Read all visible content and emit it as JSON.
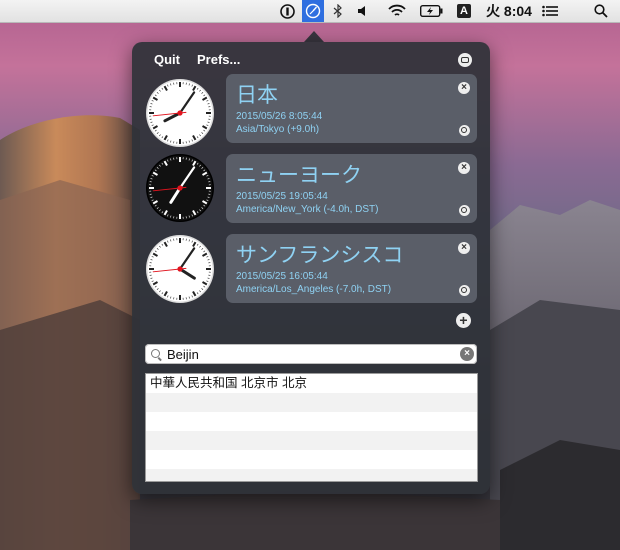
{
  "menubar": {
    "icons": [
      "1password-icon",
      "world-clock-icon",
      "bluetooth-icon",
      "volume-icon",
      "wifi-icon",
      "battery-icon",
      "input-source-icon",
      "notification-list-icon",
      "spotlight-icon"
    ],
    "input_source": "A",
    "clock": "火 8:04"
  },
  "popover": {
    "quit_label": "Quit",
    "prefs_label": "Prefs...",
    "clocks": [
      {
        "city": "日本",
        "datetime": "2015/05/26 8:05:44",
        "tz": "Asia/Tokyo (+9.0h)",
        "theme": "light",
        "hour": 8,
        "minute": 5,
        "second": 44
      },
      {
        "city": "ニューヨーク",
        "datetime": "2015/05/25 19:05:44",
        "tz": "America/New_York (-4.0h, DST)",
        "theme": "dark",
        "hour": 19,
        "minute": 5,
        "second": 44
      },
      {
        "city": "サンフランシスコ",
        "datetime": "2015/05/25 16:05:44",
        "tz": "America/Los_Angeles (-7.0h, DST)",
        "theme": "light",
        "hour": 16,
        "minute": 5,
        "second": 44
      }
    ],
    "search": {
      "value": "Beijin"
    },
    "results": [
      "中華人民共和国 北京市 北京",
      "",
      "",
      "",
      "",
      ""
    ]
  }
}
